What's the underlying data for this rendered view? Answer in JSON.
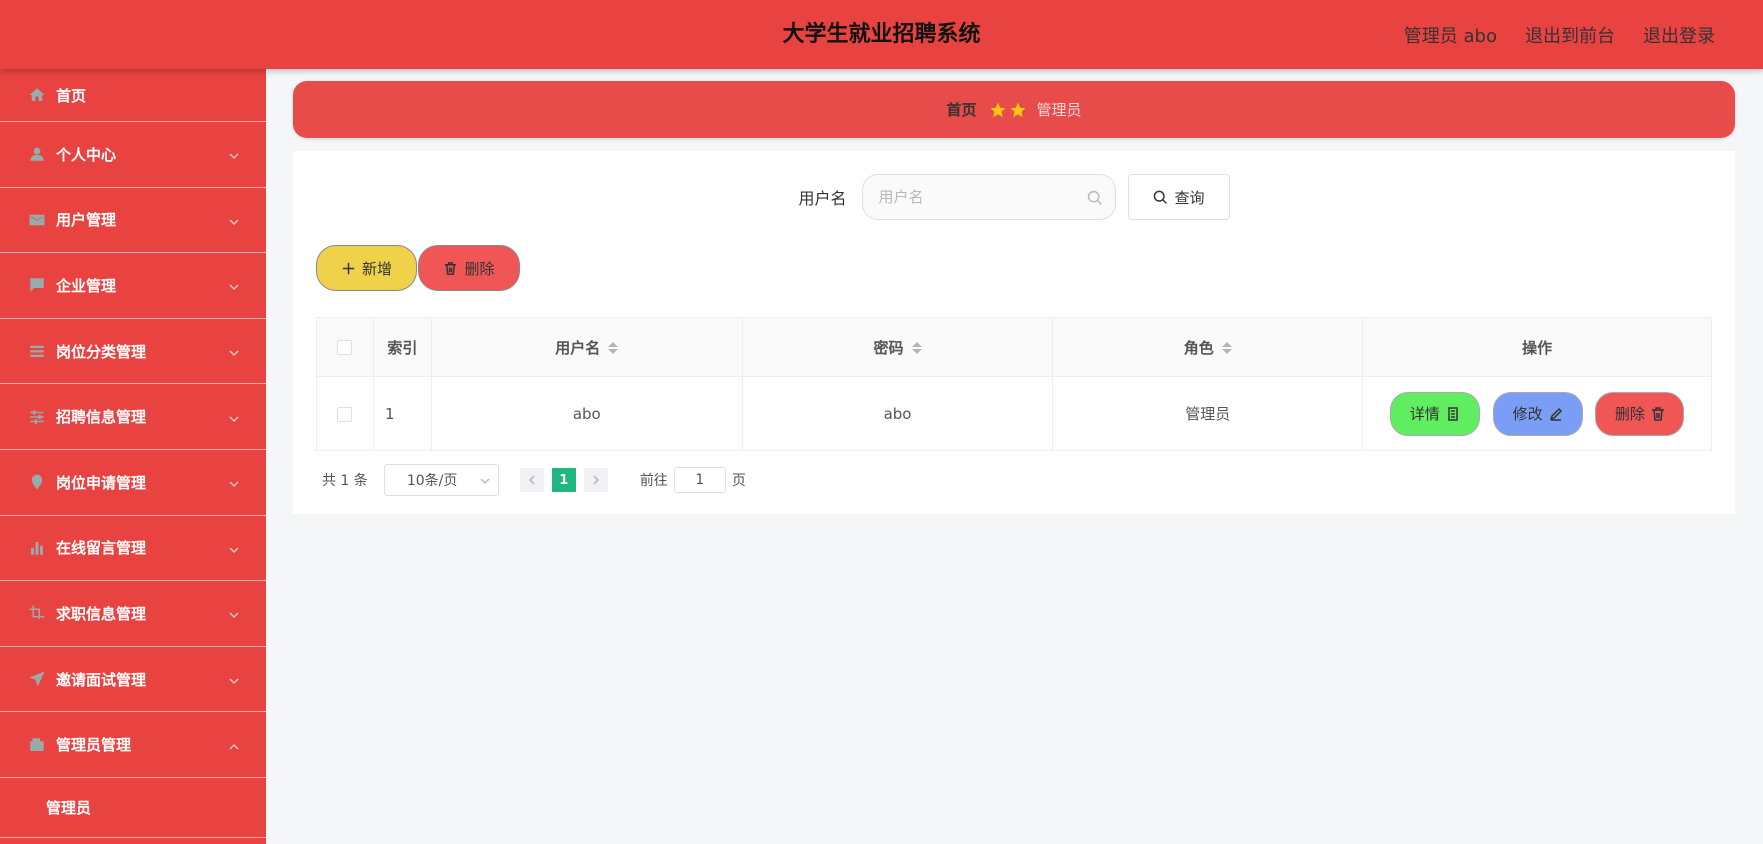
{
  "header": {
    "title": "大学生就业招聘系统",
    "user": "管理员 abo",
    "to_front": "退出到前台",
    "logout": "退出登录"
  },
  "sidebar": {
    "items": [
      {
        "label": "首页",
        "icon": "home-icon"
      },
      {
        "label": "个人中心",
        "icon": "user-icon"
      },
      {
        "label": "用户管理",
        "icon": "mail-icon"
      },
      {
        "label": "企业管理",
        "icon": "message-icon"
      },
      {
        "label": "岗位分类管理",
        "icon": "list-icon"
      },
      {
        "label": "招聘信息管理",
        "icon": "sliders-icon"
      },
      {
        "label": "岗位申请管理",
        "icon": "location-icon"
      },
      {
        "label": "在线留言管理",
        "icon": "bar-chart-icon"
      },
      {
        "label": "求职信息管理",
        "icon": "crop-icon"
      },
      {
        "label": "邀请面试管理",
        "icon": "send-icon"
      },
      {
        "label": "管理员管理",
        "icon": "wallet-icon"
      }
    ],
    "sub_item": "管理员"
  },
  "breadcrumb": {
    "home": "首页",
    "current": "管理员"
  },
  "search": {
    "label": "用户名",
    "placeholder": "用户名",
    "button": "查询"
  },
  "actions": {
    "add": "新增",
    "delete": "删除"
  },
  "table": {
    "columns": [
      "索引",
      "用户名",
      "密码",
      "角色",
      "操作"
    ],
    "rows": [
      {
        "index": "1",
        "username": "abo",
        "password": "abo",
        "role": "管理员"
      }
    ],
    "row_actions": {
      "detail": "详情",
      "edit": "修改",
      "remove": "删除"
    }
  },
  "pager": {
    "total": "共 1 条",
    "page_size": "10条/页",
    "current_page": "1",
    "goto_label": "前往",
    "goto_value": "1",
    "page_unit": "页"
  },
  "colors": {
    "primary": "#e84340",
    "add_button": "#f0d24a",
    "delete_button": "#f05656",
    "detail_button": "#60ee60",
    "edit_button": "#7a9ef5",
    "active_page": "#1fb67f"
  }
}
